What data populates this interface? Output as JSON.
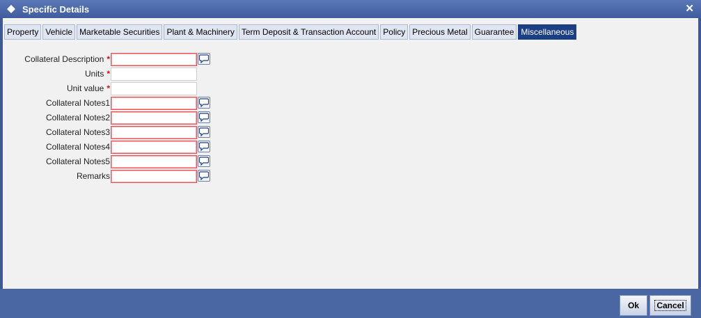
{
  "window": {
    "title": "Specific Details",
    "close_label": "✕"
  },
  "tabs": [
    {
      "label": "Property"
    },
    {
      "label": "Vehicle"
    },
    {
      "label": "Marketable Securities"
    },
    {
      "label": "Plant & Machinery"
    },
    {
      "label": "Term Deposit & Transaction Account"
    },
    {
      "label": "Policy"
    },
    {
      "label": "Precious Metal"
    },
    {
      "label": "Guarantee"
    },
    {
      "label": "Miscellaneous",
      "active": true
    }
  ],
  "form": {
    "collateral_description": {
      "label": "Collateral Description",
      "required_mark": "*",
      "value": ""
    },
    "units": {
      "label": "Units",
      "required_mark": "*",
      "value": ""
    },
    "unit_value": {
      "label": "Unit value",
      "required_mark": "*",
      "value": ""
    },
    "notes1": {
      "label": "Collateral Notes1",
      "value": ""
    },
    "notes2": {
      "label": "Collateral Notes2",
      "value": ""
    },
    "notes3": {
      "label": "Collateral Notes3",
      "value": ""
    },
    "notes4": {
      "label": "Collateral Notes4",
      "value": ""
    },
    "notes5": {
      "label": "Collateral Notes5",
      "value": ""
    },
    "remarks": {
      "label": "Remarks",
      "value": ""
    }
  },
  "footer": {
    "ok_label": "Ok",
    "cancel_label": "Cancel"
  },
  "colors": {
    "title_bar": "#3f5d9e",
    "active_tab": "#1c3f84",
    "required": "#d01010",
    "footer": "#4a67a3"
  }
}
